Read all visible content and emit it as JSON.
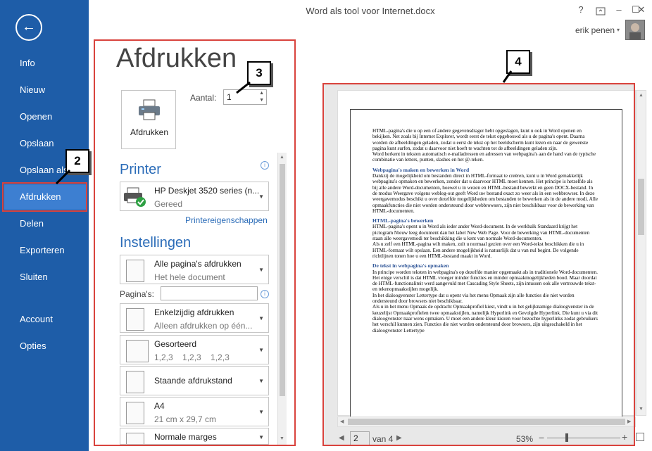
{
  "window": {
    "title": "Word als tool voor Internet.docx",
    "help": "?",
    "ribbon_icon": "ribbon-display-options-icon",
    "minimize": "–",
    "maximize": "☐",
    "close": "✕",
    "user": "erik penen"
  },
  "sidebar": {
    "items": [
      "Info",
      "Nieuw",
      "Openen",
      "Opslaan",
      "Opslaan als",
      "Afdrukken",
      "Delen",
      "Exporteren",
      "Sluiten",
      "Account",
      "Opties"
    ],
    "active_index": 5
  },
  "callouts": [
    "2",
    "3",
    "4"
  ],
  "print": {
    "heading": "Afdrukken",
    "button_label": "Afdrukken",
    "copies_label": "Aantal:",
    "copies_value": "1",
    "printer_title": "Printer",
    "printer_name": "HP Deskjet 3520 series (n...",
    "printer_status": "Gereed",
    "printer_props": "Printereigenschappen",
    "settings_title": "Instellingen",
    "pages_label": "Pagina's:",
    "settings": [
      {
        "main": "Alle pagina's afdrukken",
        "sub": "Het hele document"
      },
      {
        "main": "Enkelzijdig afdrukken",
        "sub": "Alleen afdrukken op één..."
      },
      {
        "main": "Gesorteerd",
        "sub": "1,2,3    1,2,3    1,2,3"
      },
      {
        "main": "Staande afdrukstand",
        "sub": ""
      },
      {
        "main": "A4",
        "sub": "21 cm x 29,7 cm"
      },
      {
        "main": "Normale marges",
        "sub": ""
      }
    ]
  },
  "preview": {
    "page_number": "2",
    "page_of": "van 4",
    "zoom": "53%",
    "zoom_fraction": 0.53,
    "p1": "HTML-pagina's die u op een of andere gegevensdrager hebt opgeslagen, kunt u ook in Word openen en bekijken. Net zoals bij Internet Explorer, wordt eerst de tekst opgebouwd als u de pagina's opent. Daarna worden de afbeeldingen geladen, zodat u eerst de tekst op het beeldscherm kunt lezen en naar de gewenste pagina kunt surfen, zodat u daarvoor niet hoeft te wachten tot de afbeeldingen geladen zijn.",
    "p2": "Word herkent in teksten automatisch e-mailadressen en adressen van webpagina's aan de hand van de typische combinatie van letters, punten, slashes en het @-teken.",
    "h1": "Webpagina's maken en bewerken in Word",
    "p3": "Dankzij de mogelijkheid om bestanden direct in HTML-formaat te creëren, kunt u in Word gemakkelijk webpagina's opmaken en bewerken, zonder dat u daarvoor HTML moet kennen. Het principe is hetzelfde als bij alle andere Word-documenten, hoewel u in wezen en HTML-bestand bewerkt en geen DOCX-bestand. In de modus Weergave volgens webleg-out geeft Word uw bestand exact zo weer als in een webbrowser. In deze weergavemodus beschikt u over dezelfde mogelijkheden om bestanden te bewerken als in de andere modi. Alle opmaakfuncties die niet worden ondersteund door webbrowsers, zijn niet beschikbaar voor de bewerking van HTML-documenten.",
    "h2": "HTML-pagina's bewerken",
    "p4": "HTML-pagina's opent u in Word als ieder ander Word-document. In de werkbalk Standaard krijgt het pictogram Nieuw leeg document dan het label New Web Page. Voor de bewerking van HTML-documenten staan alle weergavemodi ter beschikking die u kent van normale Word-documenten.",
    "p5": "Als u zelf een HTML-pagina wilt maken, zult u normaal gezien over een Word-tekst beschikken die u in HTML-formaat wilt opslaan. Een andere mogelijkheid is natuurlijk dat u van nul begint. De volgende richtlijnen tonen hoe u een HTML-bestand maakt in Word.",
    "h3": "De tekst in webpagina's opmaken",
    "p6": "In principe worden teksten in webpagina's op dezelfde manier opgemaakt als in traditionele Word-documenten. Het enige verschil is dat HTML vroeger minder functies en minder opmaakmogelijkheden bood. Maar doordat de HTML-functionaliteit werd aangevuld met Cascading Style Sheets, zijn intussen ook alle vertrouwde tekst- en tekenopmaakstijlen mogelijk.",
    "p7": "In het dialoogvenster Lettertype dat u opent via het menu Opmaak zijn alle functies die niet worden ondersteund door browsers niet beschikbaar.",
    "p8": "Als u in het menu Opmaak de opdracht Opmaakprofiel kiest, vindt u in het gelijknamige dialoogvenster in de keuzelijst Opmaakprofielen twee opmaakstijlen, namelijk Hyperlink en Gevolgde Hyperlink. Die kunt u via dit dialoogvenster naar wens opmaken. U moet een andere kleur kiezen voor bezochte hyperlinks zodat gebruikers het verschil kunnen zien. Functies die niet worden ondersteund door browsers, zijn uitgeschakeld in het dialoogvenster Lettertype"
  }
}
